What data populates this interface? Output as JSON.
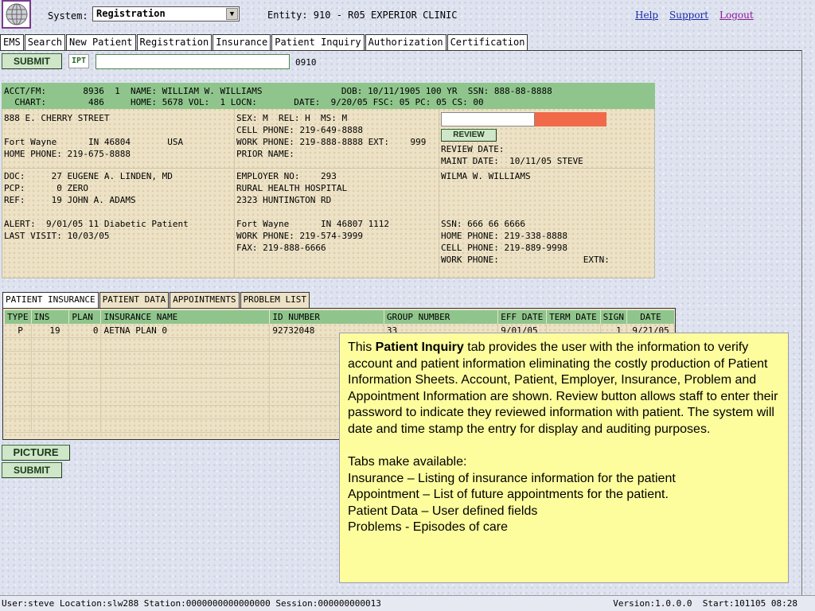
{
  "header": {
    "logo_icon": "globe-icon",
    "system_label": "System:",
    "system_value": "Registration",
    "entity": "Entity: 910 - R05 EXPERIOR CLINIC",
    "links": {
      "help": "Help",
      "support": "Support",
      "logout": "Logout"
    }
  },
  "tabs": [
    "EMS",
    "Search",
    "New Patient",
    "Registration",
    "Insurance",
    "Patient Inquiry",
    "Authorization",
    "Certification"
  ],
  "command_bar": {
    "submit": "SUBMIT",
    "ipt": "IPT",
    "input_value": "",
    "code": "0910"
  },
  "patient": {
    "header_line1": "ACCT/FM:       8936  1  NAME: WILLIAM W. WILLIAMS               DOB: 10/11/1905 100 YR  SSN: 888-88-8888",
    "header_line2": "  CHART:        486     HOME: 5678 VOL:  1 LOCN:       DATE:  9/20/05 FSC: 05 PC: 05 CS: 00",
    "address": [
      "888 E. CHERRY STREET",
      "",
      "Fort Wayne      IN 46804       USA",
      "HOME PHONE: 219-675-8888"
    ],
    "demographics": [
      "SEX: M  REL: H  MS: M",
      "CELL PHONE: 219-649-8888",
      "WORK PHONE: 219-888-8888 EXT:    999",
      "PRIOR NAME:"
    ],
    "review": {
      "button": "REVIEW",
      "review_date": "REVIEW DATE:",
      "maint_date": "MAINT DATE:  10/11/05 STEVE",
      "alert_color": "#f06a4a"
    },
    "providers": [
      "DOC:     27 EUGENE A. LINDEN, MD",
      "PCP:      0 ZERO",
      "REF:     19 JOHN A. ADAMS",
      "",
      "ALERT:  9/01/05 11 Diabetic Patient",
      "LAST VISIT: 10/03/05"
    ],
    "employer": [
      "EMPLOYER NO:    293",
      "RURAL HEALTH HOSPITAL",
      "2323 HUNTINGTON RD",
      "",
      "Fort Wayne      IN 46807 1112",
      "WORK PHONE: 219-574-3999",
      "FAX: 219-888-6666"
    ],
    "guarantor": [
      "WILMA W. WILLIAMS",
      "",
      "",
      "",
      "SSN: 666 66 6666",
      "HOME PHONE: 219-338-8888",
      "CELL PHONE: 219-889-9998",
      "WORK PHONE:                EXTN:"
    ]
  },
  "subtabs": [
    "PATIENT INSURANCE",
    "PATIENT DATA",
    "APPOINTMENTS",
    "PROBLEM LIST"
  ],
  "insurance": {
    "columns": [
      "TYPE",
      "INS",
      "PLAN",
      "INSURANCE NAME",
      "ID NUMBER",
      "GROUP NUMBER",
      "EFF DATE",
      "TERM DATE",
      "SIGN",
      "DATE"
    ],
    "rows": [
      [
        "  P",
        "   19",
        "    0",
        "AETNA PLAN 0",
        "92732048",
        "33",
        "9/01/05",
        "",
        "  1",
        "9/21/05"
      ]
    ]
  },
  "buttons": {
    "picture": "PICTURE",
    "submit": "SUBMIT"
  },
  "callout": {
    "intro_before": "This ",
    "intro_bold": "Patient Inquiry",
    "intro_after": " tab provides the user with the information to verify account and patient information eliminating the costly production of Patient Information Sheets.  Account, Patient, Employer, Insurance, Problem and Appointment Information are shown.  Review button allows staff to enter their password to indicate they reviewed information with patient.  The system will date and time stamp the entry for display and auditing purposes.",
    "tabs_heading": "Tabs make available:",
    "items": [
      "Insurance – Listing of insurance information for the patient",
      "Appointment – List of future appointments for the patient.",
      "Patient Data – User defined fields",
      "Problems  - Episodes of care"
    ]
  },
  "status": {
    "left": "User:steve Location:slw288 Station:0000000000000000 Session:000000000013",
    "right": "Version:1.0.0.0  Start:101105 08:28"
  }
}
